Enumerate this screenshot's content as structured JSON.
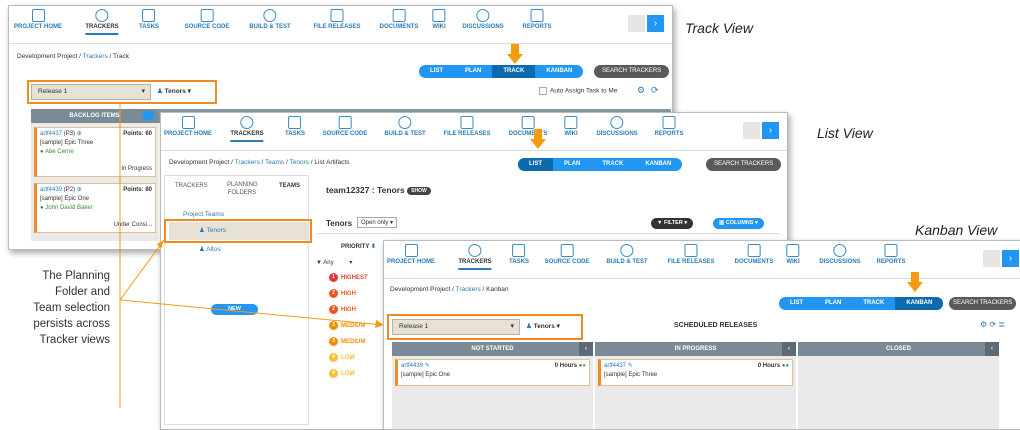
{
  "track": {
    "label": "Track View",
    "nav": [
      "PROJECT HOME",
      "TRACKERS",
      "TASKS",
      "SOURCE CODE",
      "BUILD & TEST",
      "FILE RELEASES",
      "DOCUMENTS",
      "WIKI",
      "DISCUSSIONS",
      "REPORTS"
    ],
    "crumb": {
      "root": "Development Project",
      "link": "Trackers",
      "leaf": "Track"
    },
    "views": [
      "LIST",
      "PLAN",
      "TRACK",
      "KANBAN"
    ],
    "search": "SEARCH TRACKERS",
    "release": "Release 1",
    "team": "Tenors",
    "auto_assign": "Auto Assign Task to Me",
    "backlog_header": "BACKLOG ITEMS",
    "cards": [
      {
        "id": "artf4437",
        "pri": "(P3)",
        "points_label": "Points:",
        "points": "60",
        "title": "[sample] Epic Three",
        "who": "Abe Cerne",
        "status": "In Progress"
      },
      {
        "id": "artf4439",
        "pri": "(P2)",
        "points_label": "Points:",
        "points": "80",
        "title": "[sample] Epic One",
        "who": "John David Baker",
        "status": "Under Consi..."
      }
    ]
  },
  "list": {
    "label": "List View",
    "nav": [
      "PROJECT HOME",
      "TRACKERS",
      "TASKS",
      "SOURCE CODE",
      "BUILD & TEST",
      "FILE RELEASES",
      "DOCUMENTS",
      "WIKI",
      "DISCUSSIONS",
      "REPORTS"
    ],
    "crumb": {
      "root": "Development Project",
      "link1": "Trackers",
      "link2": "Teams",
      "link3": "Tenors",
      "leaf": "List Artifacts"
    },
    "views": [
      "LIST",
      "PLAN",
      "TRACK",
      "KANBAN"
    ],
    "search": "SEARCH TRACKERS",
    "tabs": [
      "TRACKERS",
      "PLANNING FOLDERS",
      "TEAMS"
    ],
    "team_title": "team12327 : Tenors",
    "show": "SHOW",
    "project_teams": "Project Teams",
    "teams": [
      "Tenors",
      "Altos"
    ],
    "new_btn": "NEW",
    "filter_team": "Tenors",
    "open_only": "Open only",
    "filter": "FILTER",
    "columns": "COLUMNS",
    "priority_head": "PRIORITY",
    "any": "Any",
    "priorities": [
      {
        "n": "1",
        "label": "HIGHEST",
        "color": "#e53935"
      },
      {
        "n": "2",
        "label": "HIGH",
        "color": "#f4511e"
      },
      {
        "n": "2",
        "label": "HIGH",
        "color": "#f4511e"
      },
      {
        "n": "3",
        "label": "MEDIUM",
        "color": "#fb8c00"
      },
      {
        "n": "3",
        "label": "MEDIUM",
        "color": "#fb8c00"
      },
      {
        "n": "4",
        "label": "LOW",
        "color": "#fbc02d"
      },
      {
        "n": "4",
        "label": "LOW",
        "color": "#fbc02d"
      }
    ]
  },
  "kanban": {
    "label": "Kanban View",
    "nav": [
      "PROJECT HOME",
      "TRACKERS",
      "TASKS",
      "SOURCE CODE",
      "BUILD & TEST",
      "FILE RELEASES",
      "DOCUMENTS",
      "WIKI",
      "DISCUSSIONS",
      "REPORTS"
    ],
    "crumb": {
      "root": "Development Project",
      "link": "Trackers",
      "leaf": "Kanban"
    },
    "views": [
      "LIST",
      "PLAN",
      "TRACK",
      "KANBAN"
    ],
    "search": "SEARCH TRACKERS",
    "release": "Release 1",
    "team": "Tenors",
    "scheduled": "SCHEDULED RELEASES",
    "columns": [
      "NOT STARTED",
      "IN PROGRESS",
      "CLOSED"
    ],
    "cards": [
      {
        "id": "artf4439",
        "hours": "0",
        "hours_label": "Hours",
        "title": "[sample] Epic One"
      },
      {
        "id": "artf4437",
        "hours": "0",
        "hours_label": "Hours",
        "title": "[sample] Epic Three"
      }
    ]
  },
  "annotation": {
    "lines": [
      "The Planning",
      "Folder and",
      "Team selection",
      "persists across",
      "Tracker views"
    ]
  },
  "colors": {
    "accent": "#2196f3",
    "highlight": "#f08a24",
    "arrow": "#f39c12"
  }
}
